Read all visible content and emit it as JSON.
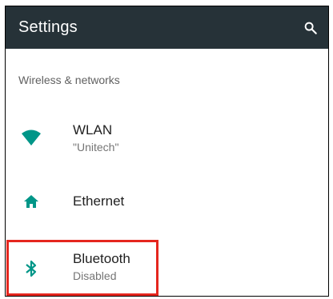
{
  "appbar": {
    "title": "Settings",
    "search_icon": "search-icon",
    "background": "#263238"
  },
  "section": {
    "header": "Wireless & networks"
  },
  "items": [
    {
      "icon": "wifi-icon",
      "title": "WLAN",
      "summary": "\"Unitech\""
    },
    {
      "icon": "home-icon",
      "title": "Ethernet",
      "summary": ""
    },
    {
      "icon": "bluetooth-icon",
      "title": "Bluetooth",
      "summary": "Disabled"
    }
  ],
  "colors": {
    "accent": "#009688",
    "highlight": "#e5261e"
  }
}
